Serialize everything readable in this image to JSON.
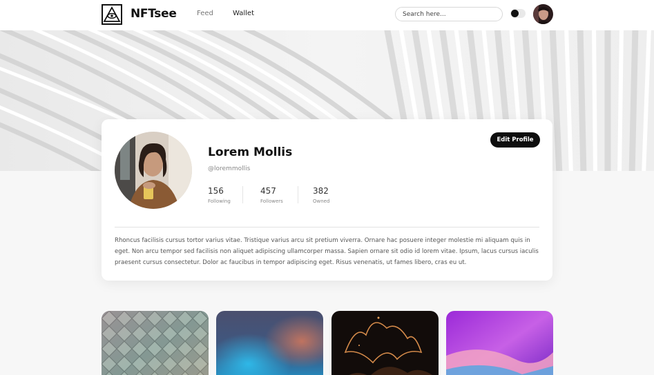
{
  "header": {
    "brand": "NFTsee",
    "nav": [
      {
        "label": "Feed"
      },
      {
        "label": "Wallet"
      }
    ],
    "search_placeholder": "Search here..."
  },
  "profile": {
    "name": "Lorem Mollis",
    "handle": "@loremmollis",
    "stats": [
      {
        "value": "156",
        "label": "Following"
      },
      {
        "value": "457",
        "label": "Followers"
      },
      {
        "value": "382",
        "label": "Owned"
      }
    ],
    "edit_label": "Edit Profile",
    "bio": "Rhoncus facilisis cursus tortor varius vitae. Tristique varius arcu sit pretium viverra. Ornare hac posuere integer molestie mi aliquam quis in eget. Non arcu tempor sed facilisis non aliquet adipiscing ullamcorper massa. Sapien ornare sit odio id lorem vitae. Ipsum, lacus cursus iaculis praesent cursus consectetur. Dolor ac faucibus in tempor adipiscing eget. Risus venenatis, ut fames libero, cras eu ut."
  },
  "icons": {
    "logo": "eye-pyramid-icon",
    "theme_toggle": "dark-mode-toggle"
  }
}
